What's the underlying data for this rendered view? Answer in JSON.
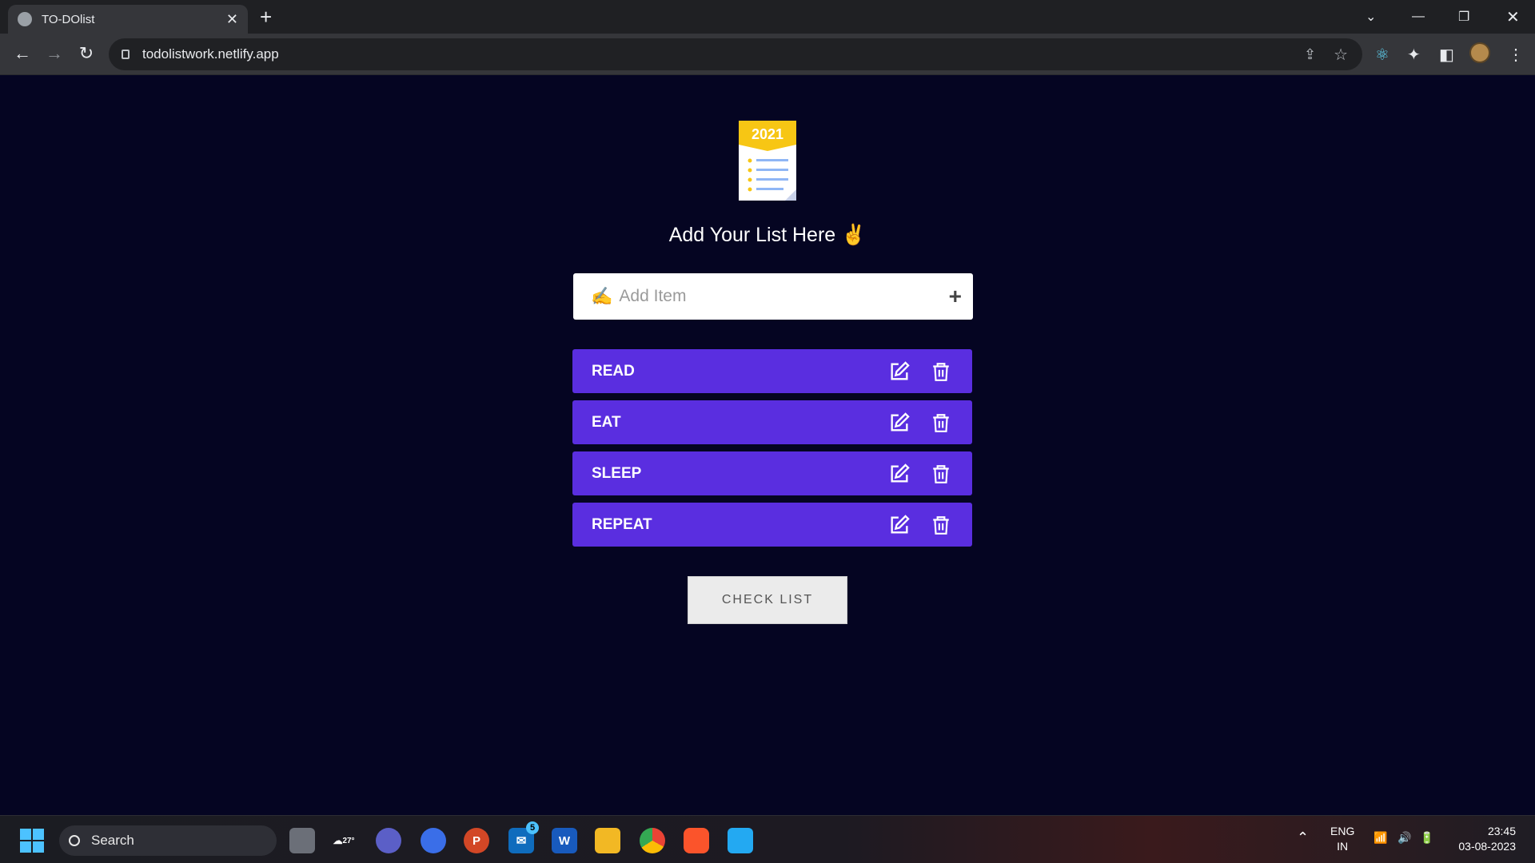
{
  "browser": {
    "tab_title": "TO-DOlist",
    "url": "todolistwork.netlify.app"
  },
  "app": {
    "logo_year": "2021",
    "heading": "Add Your List Here ✌️",
    "input": {
      "icon": "✍️",
      "placeholder": "Add Item",
      "value": ""
    },
    "items": [
      {
        "label": "READ"
      },
      {
        "label": "EAT"
      },
      {
        "label": "SLEEP"
      },
      {
        "label": "REPEAT"
      }
    ],
    "check_button": "CHECK LIST",
    "colors": {
      "background": "#050522",
      "item": "#5a2ee0",
      "logo_yellow": "#f7c614"
    }
  },
  "taskbar": {
    "search_label": "Search",
    "weather": "27°",
    "mail_badge": "5",
    "lang": "ENG",
    "region": "IN",
    "time": "23:45",
    "date": "03-08-2023"
  }
}
